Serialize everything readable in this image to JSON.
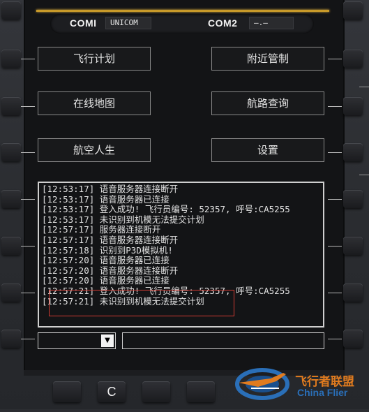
{
  "com_bar": {
    "com1_label": "COMI",
    "com1_value": "UNICOM",
    "com2_label": "COM2",
    "com2_value": "—.—"
  },
  "menu": {
    "left": [
      "飞行计划",
      "在线地图",
      "航空人生"
    ],
    "right": [
      "附近管制",
      "航路查询",
      "设置"
    ]
  },
  "log": {
    "lines": [
      "[12:53:17] 语音服务器连接断开",
      "[12:53:17] 语音服务器已连接",
      "[12:53:17] 登入成功! 飞行员编号: 52357, 呼号:CA5255",
      "[12:53:17] 未识别到机模无法提交计划",
      "[12:57:17] 服务器连接断开",
      "[12:57:17] 语音服务器连接断开",
      "[12:57:18] 识别到P3D模拟机!",
      "[12:57:20] 语音服务器已连接",
      "[12:57:20] 语音服务器连接断开",
      "[12:57:20] 语音服务器已连接",
      "[12:57:21] 登入成功! 飞行员编号: 52357, 呼号:CA5255",
      "[12:57:21] 未识别到机模无法提交计划"
    ]
  },
  "bottom_keys": {
    "clear_label": "C"
  },
  "dropdown": {
    "arrow_icon": "triangle-down-icon",
    "selected": ""
  },
  "watermark": {
    "cn": "飞行者联盟",
    "en": "China Flier"
  },
  "colors": {
    "accent": "#c89a2a",
    "highlight": "#d23b32",
    "watermark_orange": "#e07b1f",
    "watermark_blue": "#2a6fb8"
  }
}
